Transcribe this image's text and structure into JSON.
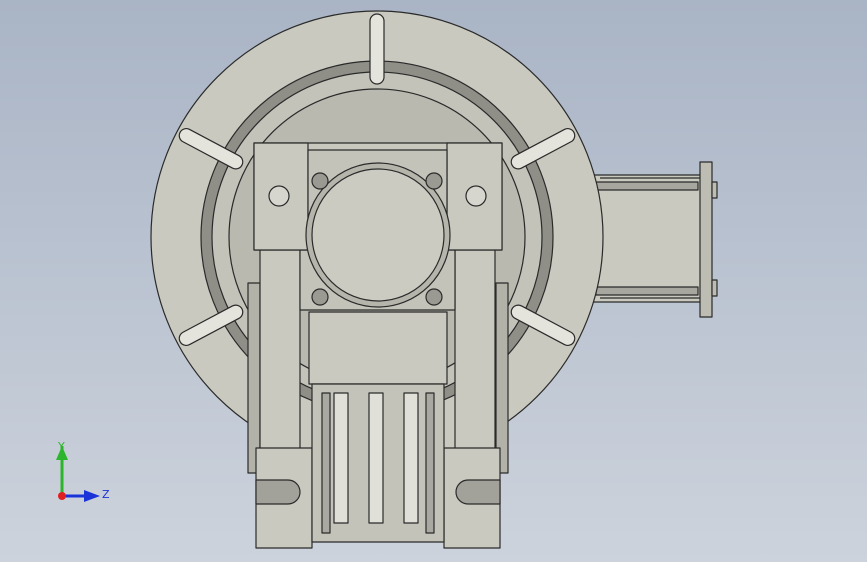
{
  "triad": {
    "y_label": "Y",
    "z_label": "Z",
    "y_color": "#2db52d",
    "z_color": "#1a33d9",
    "x_color": "#e02020"
  },
  "model": {
    "body_color": "#c9c9bf",
    "shadow_color": "#8f8f88",
    "edge_color": "#2a2a2a"
  }
}
